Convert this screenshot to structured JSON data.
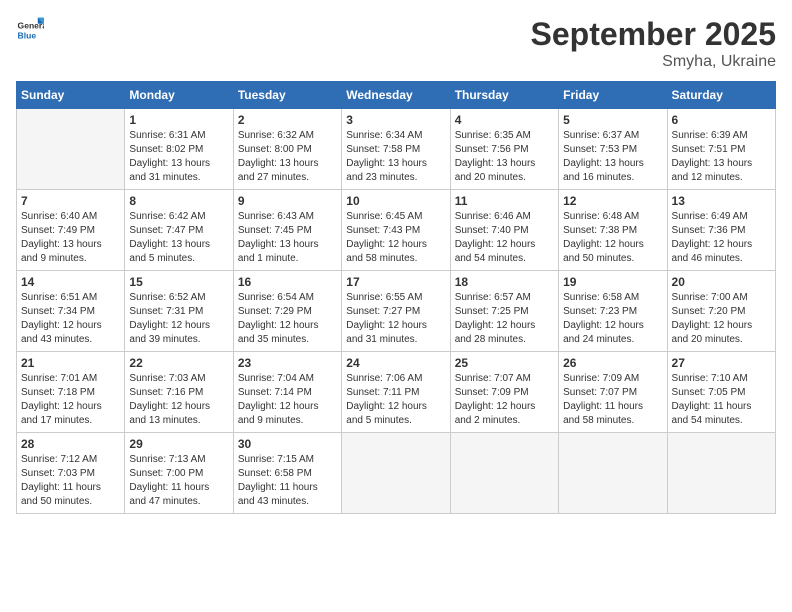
{
  "header": {
    "logo_general": "General",
    "logo_blue": "Blue",
    "month": "September 2025",
    "location": "Smyha, Ukraine"
  },
  "days_of_week": [
    "Sunday",
    "Monday",
    "Tuesday",
    "Wednesday",
    "Thursday",
    "Friday",
    "Saturday"
  ],
  "weeks": [
    [
      {
        "num": "",
        "info": ""
      },
      {
        "num": "1",
        "info": "Sunrise: 6:31 AM\nSunset: 8:02 PM\nDaylight: 13 hours\nand 31 minutes."
      },
      {
        "num": "2",
        "info": "Sunrise: 6:32 AM\nSunset: 8:00 PM\nDaylight: 13 hours\nand 27 minutes."
      },
      {
        "num": "3",
        "info": "Sunrise: 6:34 AM\nSunset: 7:58 PM\nDaylight: 13 hours\nand 23 minutes."
      },
      {
        "num": "4",
        "info": "Sunrise: 6:35 AM\nSunset: 7:56 PM\nDaylight: 13 hours\nand 20 minutes."
      },
      {
        "num": "5",
        "info": "Sunrise: 6:37 AM\nSunset: 7:53 PM\nDaylight: 13 hours\nand 16 minutes."
      },
      {
        "num": "6",
        "info": "Sunrise: 6:39 AM\nSunset: 7:51 PM\nDaylight: 13 hours\nand 12 minutes."
      }
    ],
    [
      {
        "num": "7",
        "info": "Sunrise: 6:40 AM\nSunset: 7:49 PM\nDaylight: 13 hours\nand 9 minutes."
      },
      {
        "num": "8",
        "info": "Sunrise: 6:42 AM\nSunset: 7:47 PM\nDaylight: 13 hours\nand 5 minutes."
      },
      {
        "num": "9",
        "info": "Sunrise: 6:43 AM\nSunset: 7:45 PM\nDaylight: 13 hours\nand 1 minute."
      },
      {
        "num": "10",
        "info": "Sunrise: 6:45 AM\nSunset: 7:43 PM\nDaylight: 12 hours\nand 58 minutes."
      },
      {
        "num": "11",
        "info": "Sunrise: 6:46 AM\nSunset: 7:40 PM\nDaylight: 12 hours\nand 54 minutes."
      },
      {
        "num": "12",
        "info": "Sunrise: 6:48 AM\nSunset: 7:38 PM\nDaylight: 12 hours\nand 50 minutes."
      },
      {
        "num": "13",
        "info": "Sunrise: 6:49 AM\nSunset: 7:36 PM\nDaylight: 12 hours\nand 46 minutes."
      }
    ],
    [
      {
        "num": "14",
        "info": "Sunrise: 6:51 AM\nSunset: 7:34 PM\nDaylight: 12 hours\nand 43 minutes."
      },
      {
        "num": "15",
        "info": "Sunrise: 6:52 AM\nSunset: 7:31 PM\nDaylight: 12 hours\nand 39 minutes."
      },
      {
        "num": "16",
        "info": "Sunrise: 6:54 AM\nSunset: 7:29 PM\nDaylight: 12 hours\nand 35 minutes."
      },
      {
        "num": "17",
        "info": "Sunrise: 6:55 AM\nSunset: 7:27 PM\nDaylight: 12 hours\nand 31 minutes."
      },
      {
        "num": "18",
        "info": "Sunrise: 6:57 AM\nSunset: 7:25 PM\nDaylight: 12 hours\nand 28 minutes."
      },
      {
        "num": "19",
        "info": "Sunrise: 6:58 AM\nSunset: 7:23 PM\nDaylight: 12 hours\nand 24 minutes."
      },
      {
        "num": "20",
        "info": "Sunrise: 7:00 AM\nSunset: 7:20 PM\nDaylight: 12 hours\nand 20 minutes."
      }
    ],
    [
      {
        "num": "21",
        "info": "Sunrise: 7:01 AM\nSunset: 7:18 PM\nDaylight: 12 hours\nand 17 minutes."
      },
      {
        "num": "22",
        "info": "Sunrise: 7:03 AM\nSunset: 7:16 PM\nDaylight: 12 hours\nand 13 minutes."
      },
      {
        "num": "23",
        "info": "Sunrise: 7:04 AM\nSunset: 7:14 PM\nDaylight: 12 hours\nand 9 minutes."
      },
      {
        "num": "24",
        "info": "Sunrise: 7:06 AM\nSunset: 7:11 PM\nDaylight: 12 hours\nand 5 minutes."
      },
      {
        "num": "25",
        "info": "Sunrise: 7:07 AM\nSunset: 7:09 PM\nDaylight: 12 hours\nand 2 minutes."
      },
      {
        "num": "26",
        "info": "Sunrise: 7:09 AM\nSunset: 7:07 PM\nDaylight: 11 hours\nand 58 minutes."
      },
      {
        "num": "27",
        "info": "Sunrise: 7:10 AM\nSunset: 7:05 PM\nDaylight: 11 hours\nand 54 minutes."
      }
    ],
    [
      {
        "num": "28",
        "info": "Sunrise: 7:12 AM\nSunset: 7:03 PM\nDaylight: 11 hours\nand 50 minutes."
      },
      {
        "num": "29",
        "info": "Sunrise: 7:13 AM\nSunset: 7:00 PM\nDaylight: 11 hours\nand 47 minutes."
      },
      {
        "num": "30",
        "info": "Sunrise: 7:15 AM\nSunset: 6:58 PM\nDaylight: 11 hours\nand 43 minutes."
      },
      {
        "num": "",
        "info": ""
      },
      {
        "num": "",
        "info": ""
      },
      {
        "num": "",
        "info": ""
      },
      {
        "num": "",
        "info": ""
      }
    ]
  ]
}
